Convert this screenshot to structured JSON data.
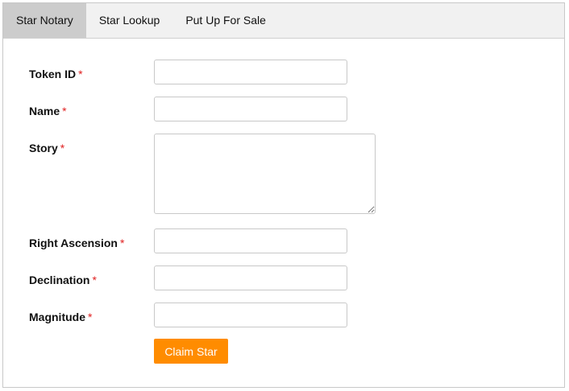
{
  "tabs": [
    {
      "label": "Star Notary",
      "active": true
    },
    {
      "label": "Star Lookup",
      "active": false
    },
    {
      "label": "Put Up For Sale",
      "active": false
    }
  ],
  "form": {
    "required_marker": "*",
    "token_id": {
      "label": "Token ID",
      "value": ""
    },
    "name": {
      "label": "Name",
      "value": ""
    },
    "story": {
      "label": "Story",
      "value": ""
    },
    "right_ascension": {
      "label": "Right Ascension",
      "value": ""
    },
    "declination": {
      "label": "Declination",
      "value": ""
    },
    "magnitude": {
      "label": "Magnitude",
      "value": ""
    },
    "submit_label": "Claim Star"
  },
  "colors": {
    "accent": "#ff8c00",
    "required": "#e02020",
    "active_tab": "#cccccc",
    "tab_bar": "#f1f1f1"
  }
}
